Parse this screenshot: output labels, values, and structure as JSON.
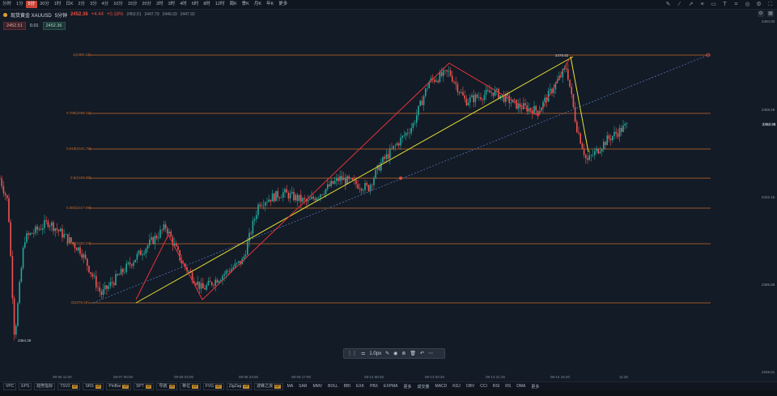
{
  "timeframes": [
    "分时",
    "1分",
    "5分",
    "30分",
    "1时",
    "日K",
    "2分",
    "3分",
    "4分",
    "10分",
    "15分",
    "20分",
    "2时",
    "3时",
    "4时",
    "6时",
    "8时",
    "12时",
    "周K",
    "季K",
    "月K",
    "年K",
    "更多"
  ],
  "active_timeframe_index": 2,
  "symbol": {
    "name": "现货黄金 XAUUSD",
    "interval": "5分钟",
    "price": "2452.36",
    "change": "+4.44",
    "change_pct": "+0.18%",
    "ohlc": [
      "2453.51",
      "2447.79",
      "2446.03",
      "2447.92"
    ]
  },
  "order": {
    "sell": "2452.51",
    "spread": "0.01",
    "buy": "2452.36"
  },
  "colors": {
    "up": "#26a69a",
    "down": "#ef5350",
    "fib": "#c76a2a",
    "yellow": "#e6e236",
    "red": "#e5333b",
    "bg": "#131b26"
  },
  "yaxis_labels": [
    {
      "v": "2494.83"
    },
    {
      "v": "2458.28"
    },
    {
      "v": "2452.36",
      "current": true
    },
    {
      "v": "2422.15"
    },
    {
      "v": "2385.88"
    },
    {
      "v": "2349.61"
    }
  ],
  "xaxis_labels": [
    "08-06 11:00",
    "08-07 06:00",
    "08-08 03:00",
    "08-08 23:55",
    "08-09 17:50",
    "08-12 08:45",
    "08-13 02:40",
    "08-13 21:25",
    "08-14 16:20",
    "11:25"
  ],
  "fib_labels": [
    "1(2486.16)",
    "0.786(2458.41)",
    "0.618(2441.75)",
    "0.5(2429.80)",
    "0.382(2417.89)",
    "0.236(2403.23)",
    "0(2378.49)"
  ],
  "chart_labels": {
    "low": "2364.29",
    "high": "2476.82"
  },
  "indicators": [
    {
      "label": "VPC",
      "vip": false
    },
    {
      "label": "EPS",
      "vip": false
    },
    {
      "label": "趋势指标",
      "vip": false
    },
    {
      "label": "TSV2",
      "vip": true
    },
    {
      "label": "SRS",
      "vip": true
    },
    {
      "label": "PinBar",
      "vip": true
    },
    {
      "label": "SPT",
      "vip": true
    },
    {
      "label": "导航",
      "vip": true
    },
    {
      "label": "移位",
      "vip": true
    },
    {
      "label": "FVG",
      "vip": true
    },
    {
      "label": "ZigZag",
      "vip": true
    },
    {
      "label": "波峰之浪",
      "vip": true
    }
  ],
  "indicators2": [
    "MA",
    "SAR",
    "MMV",
    "BOLL",
    "BBI",
    "EXK",
    "PBX",
    "EXPMA",
    "更多"
  ],
  "indicators3": [
    "成交量",
    "MACD",
    "KDJ",
    "OBV",
    "CCI",
    "RSI",
    "RS",
    "DMA",
    "更多"
  ],
  "drawbar": {
    "width_label": "1.0px"
  }
}
